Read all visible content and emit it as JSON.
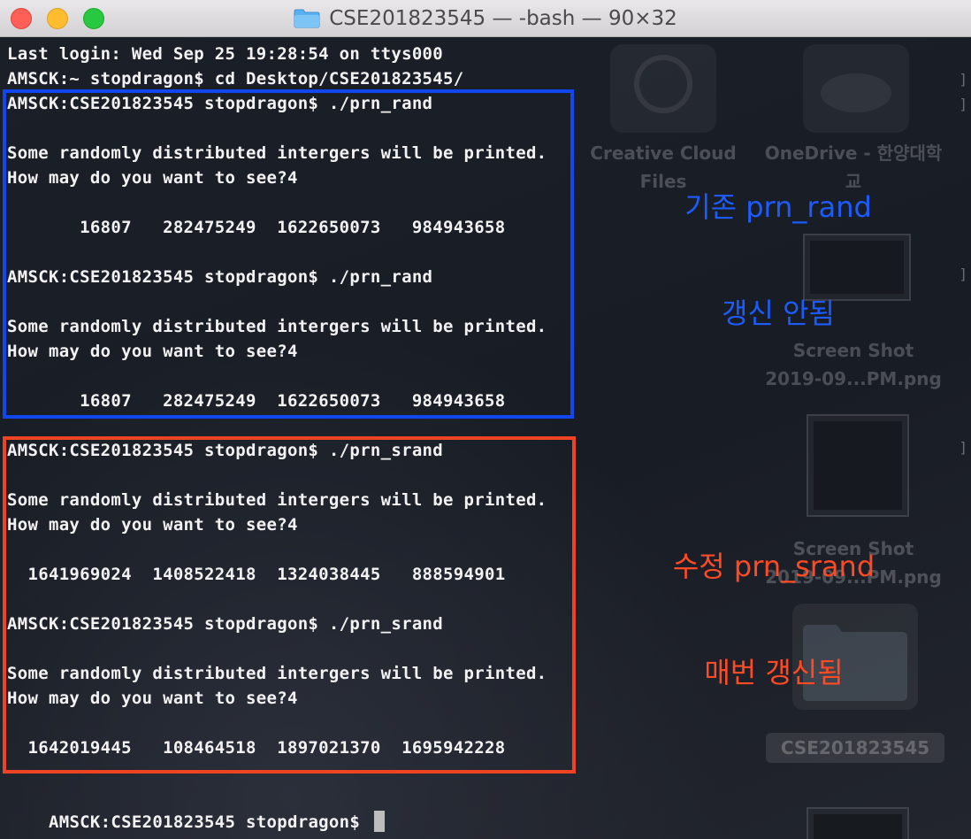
{
  "window": {
    "title": "CSE201823545 — -bash — 90×32"
  },
  "desktop": {
    "items": [
      {
        "label_line1": "Creative Cloud",
        "label_line2": "Files"
      },
      {
        "label_line1": "OneDrive - 한양대학",
        "label_line2": "교"
      },
      {
        "label_line1": "Screen Shot",
        "label_line2": "2019-09...PM.png"
      },
      {
        "label_line1": "Screen Shot",
        "label_line2": "2019-09...PM.png"
      },
      {
        "label_line1": "CSE201823545",
        "label_line2": ""
      }
    ]
  },
  "terminal": {
    "lines": [
      "Last login: Wed Sep 25 19:28:54 on ttys000",
      "AMSCK:~ stopdragon$ cd Desktop/CSE201823545/",
      "AMSCK:CSE201823545 stopdragon$ ./prn_rand",
      "",
      "Some randomly distributed intergers will be printed.",
      "How may do you want to see?4",
      "",
      "       16807   282475249  1622650073   984943658",
      "",
      "AMSCK:CSE201823545 stopdragon$ ./prn_rand",
      "",
      "Some randomly distributed intergers will be printed.",
      "How may do you want to see?4",
      "",
      "       16807   282475249  1622650073   984943658",
      "",
      "AMSCK:CSE201823545 stopdragon$ ./prn_srand",
      "",
      "Some randomly distributed intergers will be printed.",
      "How may do you want to see?4",
      "",
      "  1641969024  1408522418  1324038445   888594901",
      "",
      "AMSCK:CSE201823545 stopdragon$ ./prn_srand",
      "",
      "Some randomly distributed intergers will be printed.",
      "How may do you want to see?4",
      "",
      "  1642019445   108464518  1897021370  1695942228",
      "",
      "AMSCK:CSE201823545 stopdragon$ "
    ]
  },
  "annotations": {
    "blue": {
      "line1": "기존 prn_rand",
      "line2": "갱신 안됨",
      "color": "#1c5cff"
    },
    "red": {
      "line1": "수정 prn_srand",
      "line2": "매번 갱신됨",
      "color": "#ff4a24"
    }
  }
}
